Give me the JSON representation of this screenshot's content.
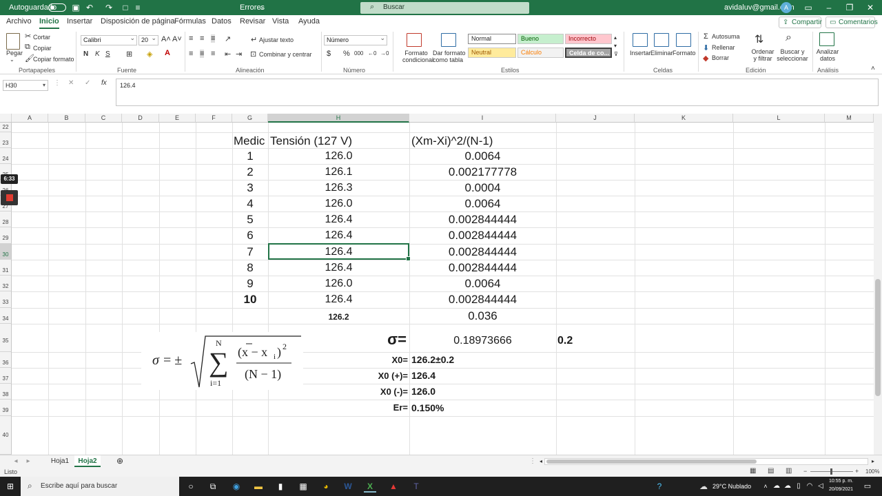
{
  "titlebar": {
    "autosave": "Autoguardado",
    "filename": "Errores",
    "search": "Buscar",
    "user_email": "avidaluv@gmail.com",
    "user_initial": "A"
  },
  "menu": {
    "tabs": [
      "Archivo",
      "Inicio",
      "Insertar",
      "Disposición de página",
      "Fórmulas",
      "Datos",
      "Revisar",
      "Vista",
      "Ayuda"
    ],
    "share": "Compartir",
    "comments": "Comentarios"
  },
  "ribbon": {
    "clipboard": {
      "paste": "Pegar",
      "cut": "Cortar",
      "copy": "Copiar",
      "format_painter": "Copiar formato",
      "label": "Portapapeles"
    },
    "font": {
      "name": "Calibri",
      "size": "20",
      "bold": "N",
      "italic": "K",
      "underline": "S",
      "label": "Fuente"
    },
    "alignment": {
      "wrap": "Ajustar texto",
      "merge": "Combinar y centrar",
      "label": "Alineación"
    },
    "number": {
      "format": "Número",
      "label": "Número"
    },
    "styles": {
      "cond_format": "Formato condicional",
      "table_format": "Dar formato como tabla",
      "normal": "Normal",
      "good": "Bueno",
      "bad": "Incorrecto",
      "neutral": "Neutral",
      "calc": "Cálculo",
      "check": "Celda de co...",
      "label": "Estilos"
    },
    "cells": {
      "insert": "Insertar",
      "delete": "Eliminar",
      "format": "Formato",
      "label": "Celdas"
    },
    "editing": {
      "autosum": "Autosuma",
      "fill": "Rellenar",
      "clear": "Borrar",
      "sort": "Ordenar y filtrar",
      "find": "Buscar y seleccionar",
      "label": "Edición"
    },
    "analysis": {
      "analyze": "Analizar datos",
      "label": "Análisis"
    }
  },
  "formula_bar": {
    "name_box": "H30",
    "value": "126.4"
  },
  "columns": [
    "A",
    "B",
    "C",
    "D",
    "E",
    "F",
    "G",
    "H",
    "I",
    "J",
    "K",
    "L",
    "M"
  ],
  "rows": [
    "22",
    "23",
    "24",
    "25",
    "26",
    "27",
    "28",
    "29",
    "30",
    "31",
    "32",
    "33",
    "34",
    "35",
    "36",
    "37",
    "38",
    "39",
    "40"
  ],
  "sheet": {
    "header_g": "Medic",
    "header_h": "Tensión (127 V)",
    "header_i": "(Xm-Xi)^2/(N-1)",
    "data": [
      {
        "n": "1",
        "v": "126.0",
        "e": "0.0064"
      },
      {
        "n": "2",
        "v": "126.1",
        "e": "0.002177778"
      },
      {
        "n": "3",
        "v": "126.3",
        "e": "0.0004"
      },
      {
        "n": "4",
        "v": "126.0",
        "e": "0.0064"
      },
      {
        "n": "5",
        "v": "126.4",
        "e": "0.002844444"
      },
      {
        "n": "6",
        "v": "126.4",
        "e": "0.002844444"
      },
      {
        "n": "7",
        "v": "126.4",
        "e": "0.002844444"
      },
      {
        "n": "8",
        "v": "126.4",
        "e": "0.002844444"
      },
      {
        "n": "9",
        "v": "126.0",
        "e": "0.0064"
      },
      {
        "n": "10",
        "v": "126.4",
        "e": "0.002844444"
      }
    ],
    "mean": "126.2",
    "sum": "0.036",
    "sigma_label": "σ=",
    "sigma_value": "0.18973666",
    "sigma_rounded": "0.2",
    "x0_label": "X0=",
    "x0_value": "126.2±0.2",
    "x0p_label": "X0 (+)=",
    "x0p_value": "126.4",
    "x0m_label": "X0 (-)=",
    "x0m_value": "126.0",
    "er_label": "Er=",
    "er_value": "0.150%"
  },
  "overlay": {
    "time": "6:33"
  },
  "sheet_tabs": [
    "Hoja1",
    "Hoja2"
  ],
  "status": {
    "ready": "Listo",
    "zoom": "100%"
  },
  "taskbar": {
    "search": "Escribe aquí para buscar",
    "weather": "29°C Nublado",
    "time": "10:55 p. m.",
    "date": "20/09/2021"
  }
}
